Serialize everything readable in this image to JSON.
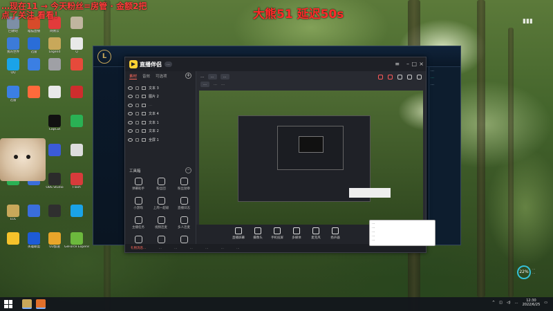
{
  "overlay": {
    "top_left_lines": [
      "…现在11 → 今天粉丝=房管 · 金额2把",
      "点了关注 看看！"
    ],
    "top_right_text": "大熊51 延迟50s"
  },
  "desktop_icons": [
    {
      "label": "回收站",
      "color": "#7d8fa6"
    },
    {
      "label": "喵猫直播",
      "color": "#d84b2a"
    },
    {
      "label": "网易云",
      "color": "#e23b3b"
    },
    {
      "label": "",
      "color": "#c0b59f"
    },
    {
      "label": "我的世界",
      "color": "#3c7bd8"
    },
    {
      "label": "迅雷",
      "color": "#2a6dd8"
    },
    {
      "label": "Legend",
      "color": "#c8a85a"
    },
    {
      "label": "Q",
      "color": "#e9e9e9"
    },
    {
      "label": "QQ",
      "color": "#1aa3e8"
    },
    {
      "label": "",
      "color": "#3b7fe3"
    },
    {
      "label": "",
      "color": "#9fa0a5"
    },
    {
      "label": "",
      "color": "#e64a3b"
    },
    {
      "label": "迅雷",
      "color": "#3b7fe3"
    },
    {
      "label": "",
      "color": "#ff6a3b"
    },
    {
      "label": "",
      "color": "#e9e9e9"
    },
    {
      "label": "",
      "color": "#ce2d2d"
    },
    {
      "label": "CapCut",
      "color": "#111111"
    },
    {
      "label": "",
      "color": "#2ab154"
    },
    {
      "label": "",
      "color": "#3b5bd8"
    },
    {
      "label": "",
      "color": "#dddddd"
    },
    {
      "label": "",
      "color": "#2ab154"
    },
    {
      "label": "",
      "color": "#3a6edc"
    },
    {
      "label": "OBS Studio",
      "color": "#2b2b2b"
    },
    {
      "label": "Flash",
      "color": "#d83b3b"
    },
    {
      "label": "LOL",
      "color": "#c8a85a"
    },
    {
      "label": "",
      "color": "#3a6edc"
    },
    {
      "label": "",
      "color": "#2f2f2f"
    },
    {
      "label": "",
      "color": "#1aa3e8"
    },
    {
      "label": "",
      "color": "#f5c22b"
    },
    {
      "label": "英雄联盟",
      "color": "#1d5bd6"
    },
    {
      "label": "UU加速",
      "color": "#e8a52a"
    },
    {
      "label": "GeForce Experience",
      "color": "#6cb93d"
    }
  ],
  "app": {
    "name": "直播伴侣",
    "version": "…",
    "tabs": [
      "素材",
      "音效",
      "可选项"
    ],
    "sources": [
      {
        "label": "文本 3",
        "dim": false
      },
      {
        "label": "图片 2",
        "dim": false
      },
      {
        "label": "…",
        "dim": true
      },
      {
        "label": "文本 4",
        "dim": false
      },
      {
        "label": "文本 1",
        "dim": false
      },
      {
        "label": "文本 2",
        "dim": false
      },
      {
        "label": "全屏 1",
        "dim": false
      }
    ],
    "tools_title": "工具箱",
    "tools": [
      "弹幕助手",
      "粉丝团",
      "粉丝勋章",
      "小游戏",
      "上周一超级",
      "直播日志",
      "主播任务",
      "视频连麦",
      "多人连麦",
      "…",
      "…",
      "…"
    ],
    "room_title": "…",
    "room_chip": "…",
    "room_chip2": "…",
    "meta": [
      "…",
      "…",
      "…"
    ],
    "bottom_items": [
      "直播屏幕",
      "摄像头",
      "手机投屏",
      "多媒体",
      "麦克风",
      "扬声器"
    ],
    "status_bar": [
      "礼物消息…",
      "…",
      "…",
      "…",
      "…",
      "…",
      "…"
    ]
  },
  "tip_lines": [
    "…",
    "…",
    "…",
    "…",
    "…"
  ],
  "lol": {
    "right_panel": [
      "…",
      "…",
      "…"
    ]
  },
  "widgets": {
    "gauge_value": "22%",
    "cpu_lines": [
      "…",
      "…"
    ]
  },
  "taskbar": {
    "time": "12:30",
    "date": "2022/6/25",
    "tray_text": "…"
  }
}
